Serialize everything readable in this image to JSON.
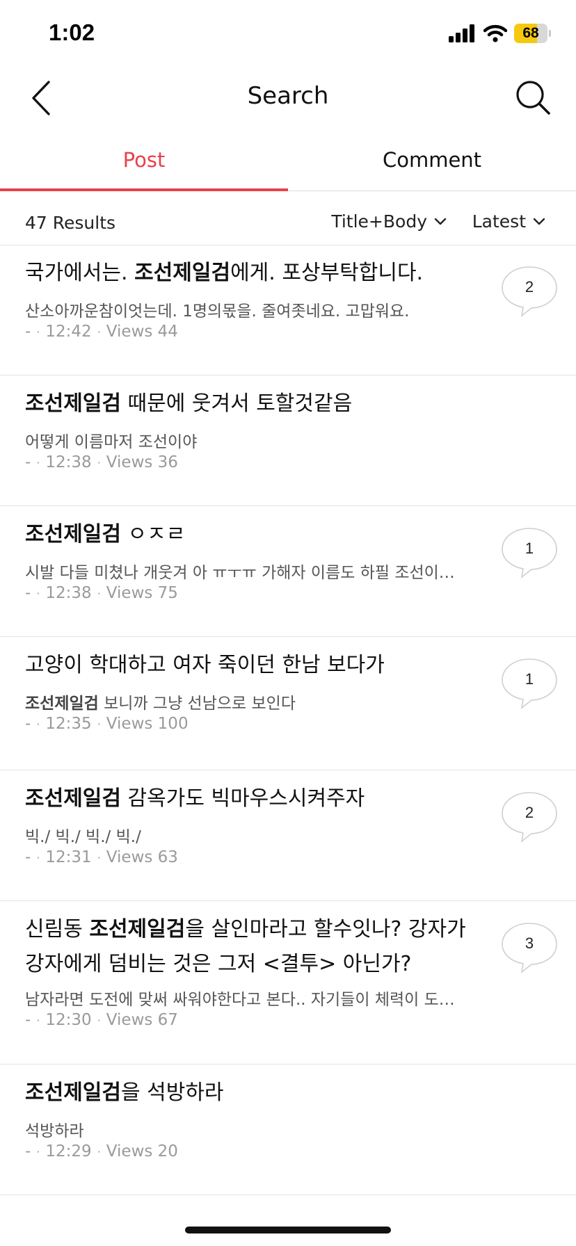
{
  "status_bar": {
    "time": "1:02",
    "battery_level": "68",
    "battery_fraction": 0.68
  },
  "nav": {
    "title": "Search",
    "back_icon": "chevron-left-icon",
    "search_icon": "search-icon"
  },
  "tabs": [
    {
      "label": "Post",
      "active": true
    },
    {
      "label": "Comment",
      "active": false
    }
  ],
  "filters": {
    "results": "47 Results",
    "field": "Title+Body",
    "sort": "Latest"
  },
  "colors": {
    "accent": "#e8414b",
    "battery": "#f6c90e"
  },
  "posts": [
    {
      "title_parts": [
        {
          "t": "국가에서는. "
        },
        {
          "t": "조선제일검",
          "b": true
        },
        {
          "t": "에게. 포상부탁합니다."
        }
      ],
      "body_parts": [
        {
          "t": "산소아까운참이엇는데. 1명의몫을. 줄여좃네요. 고맙워요."
        }
      ],
      "author": "-",
      "time": "12:42",
      "views": "Views 44",
      "comments": "2"
    },
    {
      "title_parts": [
        {
          "t": "조선제일검",
          "b": true
        },
        {
          "t": " 때문에 웃겨서 토할것같음"
        }
      ],
      "body_parts": [
        {
          "t": "어떻게 이름마저 조선이야"
        }
      ],
      "author": "-",
      "time": "12:38",
      "views": "Views 36",
      "comments": ""
    },
    {
      "title_parts": [
        {
          "t": "조선제일검",
          "b": true
        },
        {
          "t": " ㅇㅈㄹ"
        }
      ],
      "body_parts": [
        {
          "t": "시발 다들 미쳤나 개웃겨 아 ㅠㅜㅠ 가해자 이름도 하필 조선이…"
        }
      ],
      "author": "-",
      "time": "12:38",
      "views": "Views 75",
      "comments": "1"
    },
    {
      "title_parts": [
        {
          "t": "고양이 학대하고 여자 죽이던 한남 보다가"
        }
      ],
      "body_parts": [
        {
          "t": "조선제일검",
          "b": true
        },
        {
          "t": " 보니까 그냥 선남으로 보인다"
        }
      ],
      "author": "-",
      "time": "12:35",
      "views": "Views 100",
      "comments": "1"
    },
    {
      "title_parts": [
        {
          "t": "조선제일검",
          "b": true
        },
        {
          "t": " 감옥가도 빅마우스시켜주자"
        }
      ],
      "body_parts": [
        {
          "t": "빅./ 빅./ 빅./ 빅./"
        }
      ],
      "author": "-",
      "time": "12:31",
      "views": "Views 63",
      "comments": "2"
    },
    {
      "title_parts": [
        {
          "t": "신림동 "
        },
        {
          "t": "조선제일검",
          "b": true
        },
        {
          "t": "을 살인마라고 할수잇나? 강자가 강자에게 덤비는 것은 그저 <결투> 아닌가?"
        }
      ],
      "body_parts": [
        {
          "t": "남자라면 도전에 맞써 싸워야한다고 본다.. 자기들이 체력이 도…"
        }
      ],
      "author": "-",
      "time": "12:30",
      "views": "Views 67",
      "comments": "3"
    },
    {
      "title_parts": [
        {
          "t": "조선제일검",
          "b": true
        },
        {
          "t": "을 석방하라"
        }
      ],
      "body_parts": [
        {
          "t": "석방하라"
        }
      ],
      "author": "-",
      "time": "12:29",
      "views": "Views 20",
      "comments": ""
    }
  ]
}
